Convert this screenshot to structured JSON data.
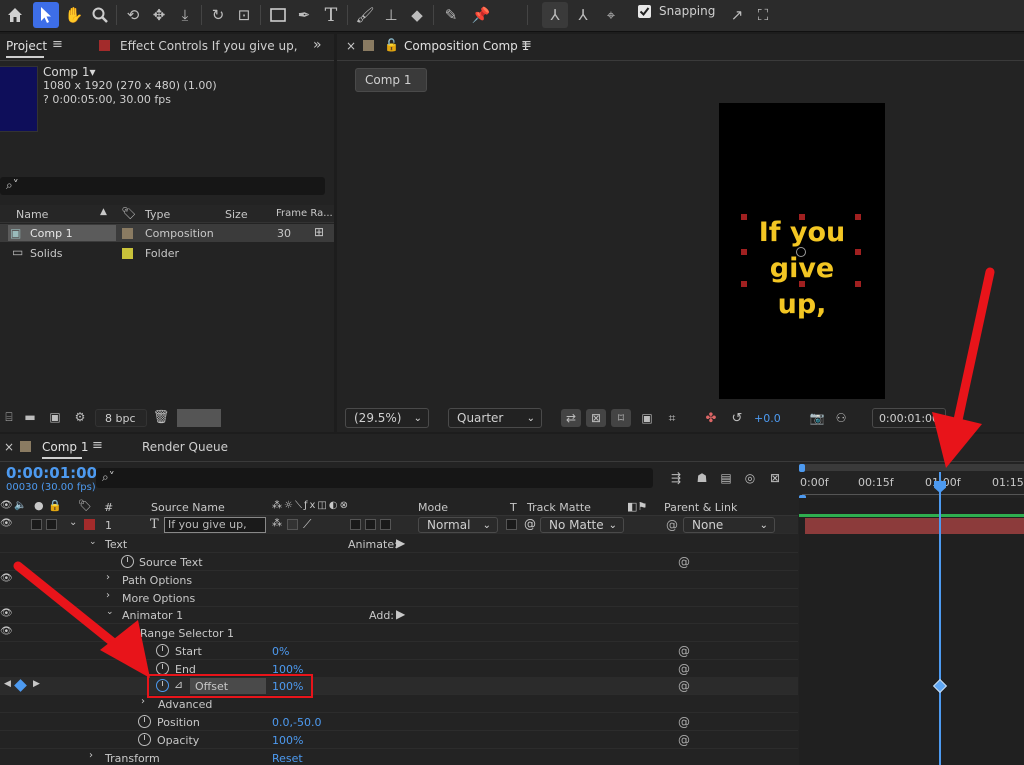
{
  "toolbar": {
    "snapping_label": "Snapping",
    "snapping_checked": true
  },
  "project": {
    "tab_label": "Project",
    "effect_controls_label": "Effect Controls If you give up,",
    "comp_name": "Comp 1▾",
    "comp_size": "1080 x 1920  (270 x 480) (1.00)",
    "comp_duration": "? 0:00:05:00, 30.00 fps",
    "search_icon": "⌕˅",
    "columns": {
      "name": "Name",
      "type": "Type",
      "size": "Size",
      "frame_rate": "Frame Ra..."
    },
    "items": [
      {
        "name": "Comp 1",
        "type": "Composition",
        "frame_rate": "30",
        "color": "#8a7b62"
      },
      {
        "name": "Solids",
        "type": "Folder",
        "frame_rate": "",
        "color": "#c9c23a"
      }
    ],
    "bpc_label": "8 bpc"
  },
  "composition": {
    "tab_label": "Composition Comp 1",
    "comp_button": "Comp 1",
    "preview_text_line1": "If you",
    "preview_text_line2": "give up,",
    "zoom_value": "(29.5%)",
    "resolution_value": "Quarter",
    "exposure_value": "+0.0",
    "timecode": "0:00:01:00"
  },
  "timeline": {
    "tab_label": "Comp 1",
    "render_queue_label": "Render Queue",
    "current_time": "0:00:01:00",
    "frame_info": "00030 (30.00 fps)",
    "search_icon": "⌕˅",
    "ruler_labels": [
      "0:00f",
      "00:15f",
      "01:00f",
      "01:15f"
    ],
    "columns": {
      "index": "#",
      "source_name": "Source Name",
      "mode": "Mode",
      "t": "T",
      "track_matte": "Track Matte",
      "parent_link": "Parent & Link"
    },
    "layer": {
      "index": "1",
      "name": "If you give up,",
      "mode": "Normal",
      "track_matte": "No Matte",
      "parent": "None"
    },
    "rows": {
      "text": "Text",
      "animate": "Animate:",
      "source_text": "Source Text",
      "path_options": "Path Options",
      "more_options": "More Options",
      "animator": "Animator 1",
      "add": "Add:",
      "range_selector": "Range Selector 1",
      "start": "Start",
      "start_value": "0%",
      "end": "End",
      "end_value": "100%",
      "offset": "Offset",
      "offset_value": "100%",
      "advanced": "Advanced",
      "position": "Position",
      "position_value": "0.0,-50.0",
      "opacity": "Opacity",
      "opacity_value": "100%",
      "transform": "Transform",
      "reset": "Reset"
    }
  },
  "colors": {
    "accent_blue": "#4d9af0",
    "highlight_red": "#e8141a",
    "text_yellow": "#f3c623",
    "layer_bar": "#8c3b3b"
  }
}
